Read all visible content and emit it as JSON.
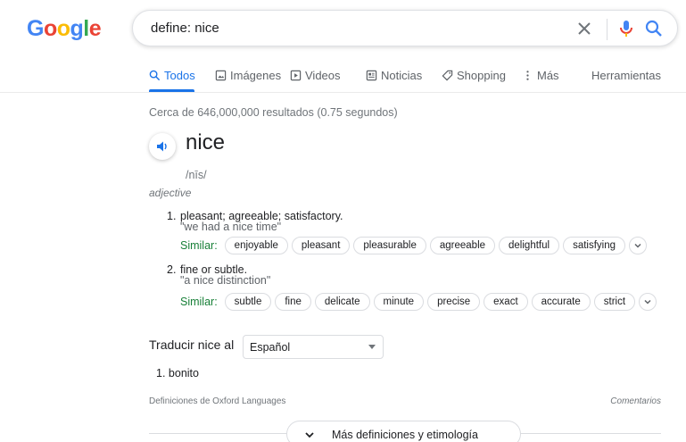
{
  "logo": {
    "l1": "G",
    "l2": "o",
    "l3": "o",
    "l4": "g",
    "l5": "l",
    "l6": "e"
  },
  "search": {
    "query": "define: nice"
  },
  "tabs": [
    {
      "label": "Todos",
      "icon": "search-icon",
      "active": true
    },
    {
      "label": "Imágenes",
      "icon": "image-icon"
    },
    {
      "label": "Videos",
      "icon": "video-icon"
    },
    {
      "label": "Noticias",
      "icon": "news-icon"
    },
    {
      "label": "Shopping",
      "icon": "tag-icon"
    },
    {
      "label": "Más",
      "icon": "more-vert-icon"
    },
    {
      "label": "Herramientas"
    }
  ],
  "results": {
    "stats": "Cerca de 646,000,000 resultados (0.75 segundos)"
  },
  "definition": {
    "word": "nice",
    "phonetic": "/nīs/",
    "part_of_speech": "adjective",
    "senses": [
      {
        "number": "1.",
        "definition": "pleasant; agreeable; satisfactory.",
        "example": "\"we had a nice time\"",
        "similar_label": "Similar:",
        "similar": [
          "enjoyable",
          "pleasant",
          "pleasurable",
          "agreeable",
          "delightful",
          "satisfying"
        ]
      },
      {
        "number": "2.",
        "definition": "fine or subtle.",
        "example": "\"a nice distinction\"",
        "similar_label": "Similar:",
        "similar": [
          "subtle",
          "fine",
          "delicate",
          "minute",
          "precise",
          "exact",
          "accurate",
          "strict"
        ]
      }
    ]
  },
  "translate": {
    "label": "Traducir nice al",
    "language": "Español",
    "items": [
      {
        "number": "1.",
        "text": "bonito"
      }
    ]
  },
  "footer": {
    "source": "Definiciones de Oxford Languages",
    "feedback": "Comentarios",
    "more_label": "Más definiciones y etimología"
  },
  "colors": {
    "accent": "#1a73e8",
    "similar": "#188038",
    "mic_blue": "#4285f4",
    "mic_red": "#ea4335"
  }
}
